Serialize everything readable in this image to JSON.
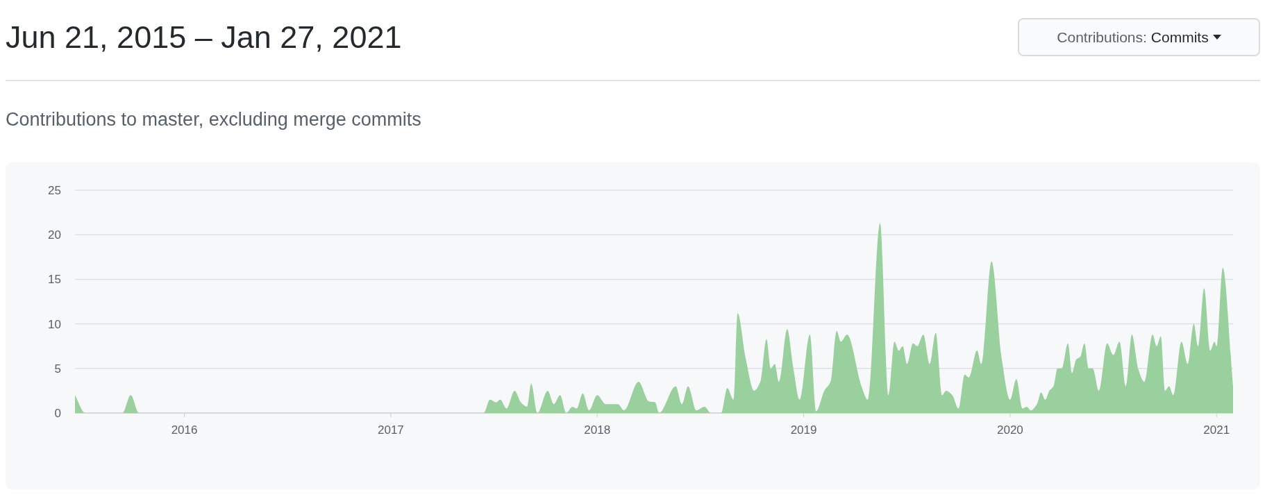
{
  "title": "Jun 21, 2015 – Jan 27, 2021",
  "filter_button": {
    "label": "Contributions:",
    "value": "Commits"
  },
  "subtitle": "Contributions to master, excluding merge commits",
  "chart": {
    "chart_data": {
      "type": "area",
      "grid": true,
      "xlim": [
        2015.47,
        2021.08
      ],
      "ylim": [
        0,
        25
      ],
      "xticks": [
        {
          "value": 2016,
          "label": "2016"
        },
        {
          "value": 2017,
          "label": "2017"
        },
        {
          "value": 2018,
          "label": "2018"
        },
        {
          "value": 2019,
          "label": "2019"
        },
        {
          "value": 2020,
          "label": "2020"
        },
        {
          "value": 2021,
          "label": "2021"
        }
      ],
      "yticks": [
        0,
        5,
        10,
        15,
        20,
        25
      ],
      "x": [
        2015.47,
        2015.52,
        2015.7,
        2015.74,
        2015.78,
        2017.45,
        2017.48,
        2017.51,
        2017.53,
        2017.56,
        2017.6,
        2017.63,
        2017.66,
        2017.68,
        2017.71,
        2017.76,
        2017.79,
        2017.82,
        2017.85,
        2017.88,
        2017.9,
        2017.93,
        2017.96,
        2018.0,
        2018.04,
        2018.1,
        2018.13,
        2018.2,
        2018.25,
        2018.28,
        2018.3,
        2018.38,
        2018.41,
        2018.44,
        2018.48,
        2018.52,
        2018.55,
        2018.6,
        2018.63,
        2018.66,
        2018.68,
        2018.72,
        2018.76,
        2018.79,
        2018.82,
        2018.84,
        2018.86,
        2018.88,
        2018.92,
        2018.95,
        2018.98,
        2019.03,
        2019.06,
        2019.1,
        2019.13,
        2019.16,
        2019.18,
        2019.21,
        2019.28,
        2019.31,
        2019.37,
        2019.41,
        2019.44,
        2019.46,
        2019.48,
        2019.5,
        2019.53,
        2019.55,
        2019.58,
        2019.61,
        2019.64,
        2019.67,
        2019.69,
        2019.72,
        2019.75,
        2019.78,
        2019.8,
        2019.84,
        2019.86,
        2019.91,
        2019.96,
        2020.0,
        2020.03,
        2020.06,
        2020.08,
        2020.1,
        2020.13,
        2020.15,
        2020.17,
        2020.19,
        2020.21,
        2020.23,
        2020.25,
        2020.28,
        2020.3,
        2020.32,
        2020.34,
        2020.36,
        2020.38,
        2020.4,
        2020.43,
        2020.47,
        2020.5,
        2020.53,
        2020.56,
        2020.59,
        2020.62,
        2020.65,
        2020.69,
        2020.71,
        2020.73,
        2020.75,
        2020.77,
        2020.79,
        2020.83,
        2020.86,
        2020.89,
        2020.91,
        2020.94,
        2020.97,
        2020.99,
        2021.0,
        2021.03,
        2021.08
      ],
      "series": [
        {
          "color": "#9acf9e",
          "values": [
            2,
            0,
            0,
            2,
            0,
            0,
            1.5,
            1.2,
            1.5,
            0.5,
            2.5,
            1.2,
            0.7,
            3.3,
            0,
            2.5,
            1,
            2,
            0,
            0.7,
            0.5,
            2.2,
            0.3,
            2,
            1,
            1,
            0.3,
            3.5,
            1.3,
            1.2,
            0,
            3,
            1,
            3,
            0.3,
            0.7,
            0,
            0,
            2.8,
            1.5,
            11.2,
            6,
            2.5,
            3.5,
            8.3,
            5,
            5.5,
            3.5,
            9.4,
            5,
            1.5,
            8.8,
            0.2,
            2.5,
            3.5,
            9.2,
            8,
            8.8,
            3,
            1.5,
            21.3,
            2,
            8,
            7,
            7.5,
            5.5,
            7.8,
            7.5,
            8.8,
            5.5,
            9,
            2,
            2.5,
            2,
            0.5,
            4.3,
            4,
            7,
            5.5,
            17,
            6,
            1.5,
            3.8,
            0.5,
            0.7,
            0.3,
            1,
            2.3,
            1.5,
            2.5,
            3,
            5,
            5,
            7.8,
            4.5,
            6,
            6.3,
            7.8,
            5,
            5,
            2.5,
            7.8,
            6.5,
            8,
            3,
            8.8,
            5,
            3.5,
            8.8,
            7.5,
            8.6,
            2.5,
            3,
            2,
            8,
            5.5,
            10,
            7.5,
            14,
            7,
            8,
            7.5,
            16.3,
            3
          ]
        }
      ]
    }
  }
}
